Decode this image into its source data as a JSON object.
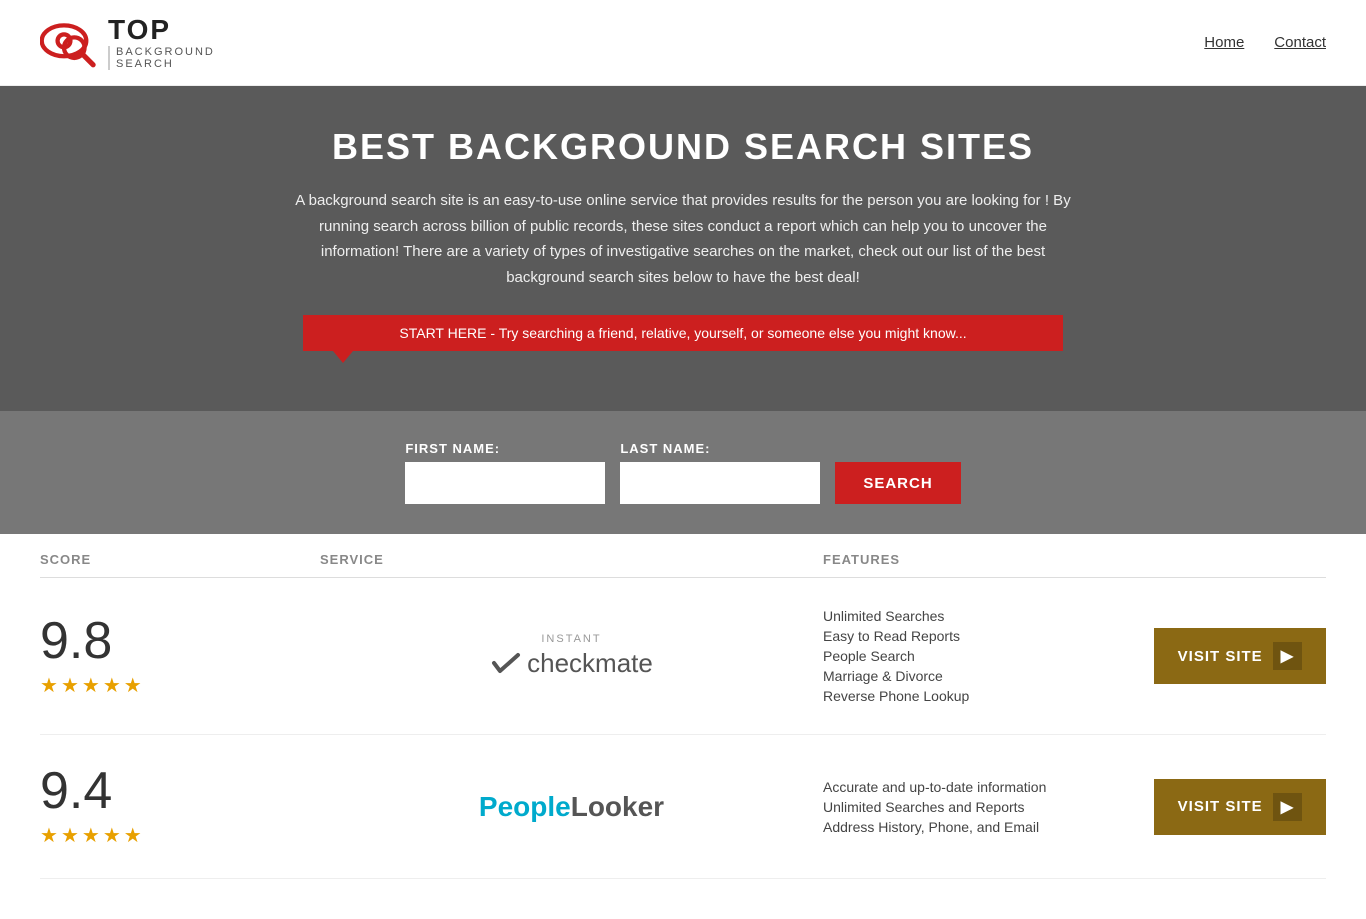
{
  "header": {
    "logo_top": "TOP",
    "logo_bottom": "BACKGROUND\nSEARCH",
    "nav_home": "Home",
    "nav_contact": "Contact"
  },
  "hero": {
    "title": "BEST BACKGROUND SEARCH SITES",
    "description": "A background search site is an easy-to-use online service that provides results  for the person you are looking for ! By  running  search across billion of public records, these sites conduct  a report which can help you to uncover the information! There are a variety of types of investigative searches on the market, check out our  list of the best background search sites below to have the best deal!",
    "search_banner": "START HERE - Try searching a friend, relative, yourself, or someone else you might know..."
  },
  "search_form": {
    "first_name_label": "FIRST NAME:",
    "last_name_label": "LAST NAME:",
    "search_button_label": "SEARCH"
  },
  "table": {
    "col_score": "SCORE",
    "col_service": "SERVICE",
    "col_features": "FEATURES"
  },
  "results": [
    {
      "score": "9.8",
      "stars": 4.5,
      "service_name": "Instant Checkmate",
      "service_label": "instantcheckmate",
      "features": [
        "Unlimited Searches",
        "Easy to Read Reports",
        "People Search",
        "Marriage & Divorce",
        "Reverse Phone Lookup"
      ],
      "visit_label": "VISIT SITE"
    },
    {
      "score": "9.4",
      "stars": 4.5,
      "service_name": "PeopleLooker",
      "service_label": "peoplelooker",
      "features": [
        "Accurate and up-to-date information",
        "Unlimited Searches and Reports",
        "Address History, Phone, and Email"
      ],
      "visit_label": "VISIT SITE"
    }
  ]
}
